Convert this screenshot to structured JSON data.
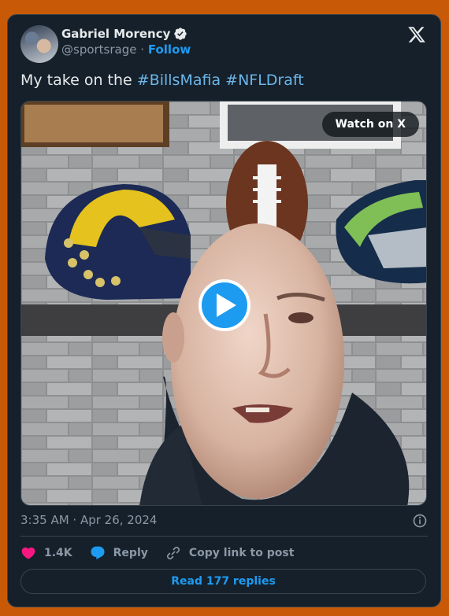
{
  "author": {
    "name": "Gabriel Morency",
    "handle": "@sportsrage",
    "separator": "·",
    "follow_label": "Follow"
  },
  "tweet": {
    "text_prefix": "My take on the ",
    "hashtags": [
      "#BillsMafia",
      "#NFLDraft"
    ]
  },
  "media": {
    "watch_label": "Watch on X"
  },
  "meta": {
    "timestamp": "3:35 AM · Apr 26, 2024"
  },
  "actions": {
    "likes": "1.4K",
    "reply_label": "Reply",
    "copy_label": "Copy link to post"
  },
  "read_replies_label": "Read 177 replies",
  "colors": {
    "background": "#c85a07",
    "card": "#15202b",
    "accent": "#1d9bf0",
    "like": "#f91880"
  }
}
